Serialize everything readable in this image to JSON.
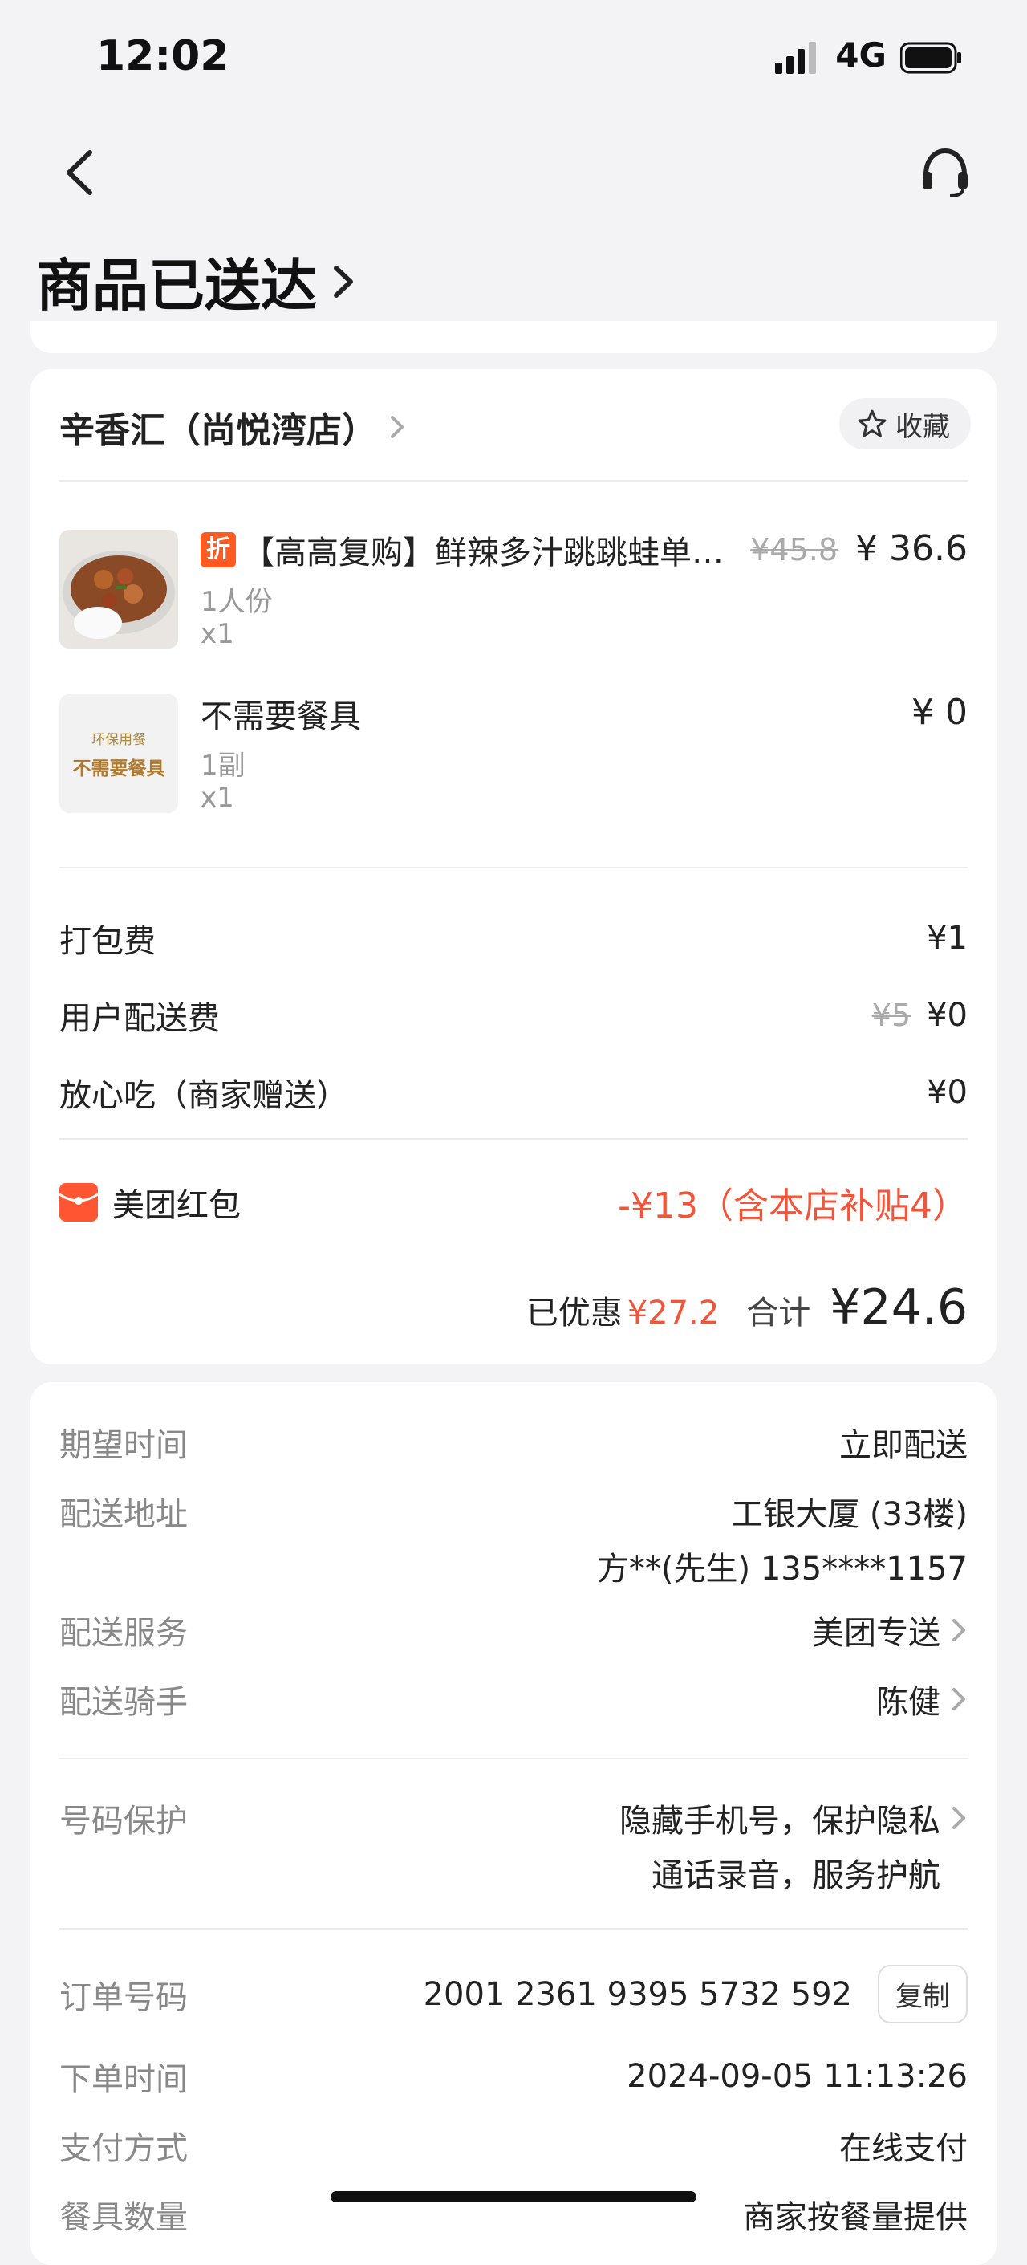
{
  "status": {
    "time": "12:02",
    "network": "4G"
  },
  "header": {
    "title": "商品已送达"
  },
  "shop": {
    "name": "辛香汇（尚悦湾店）",
    "favorite_label": "收藏"
  },
  "items": [
    {
      "tag": "折",
      "name": "【高高复购】鲜辣多汁跳跳蛙单…",
      "spec": "1人份",
      "qty": "x1",
      "original_price": "¥45.8",
      "price": "¥ 36.6"
    },
    {
      "name": "不需要餐具",
      "spec": "1副",
      "qty": "x1",
      "price": "¥ 0",
      "thumb_top": "环保用餐",
      "thumb_main": "不需要餐具"
    }
  ],
  "fees": {
    "packing": {
      "label": "打包费",
      "value": "¥1"
    },
    "delivery": {
      "label": "用户配送费",
      "original": "¥5",
      "value": "¥0"
    },
    "safe_eat": {
      "label": "放心吃（商家赠送）",
      "value": "¥0"
    }
  },
  "red_packet": {
    "label": "美团红包",
    "value": "-¥13（含本店补贴4）"
  },
  "summary": {
    "saved_label": "已优惠",
    "saved_value": "¥27.2",
    "total_label": "合计",
    "total_value": "¥24.6"
  },
  "delivery": {
    "expected_time": {
      "label": "期望时间",
      "value": "立即配送"
    },
    "address": {
      "label": "配送地址",
      "line1": "工银大厦 (33楼)",
      "line2": "方**(先生) 135****1157"
    },
    "service": {
      "label": "配送服务",
      "value": "美团专送"
    },
    "rider": {
      "label": "配送骑手",
      "value": "陈健"
    },
    "privacy": {
      "label": "号码保护",
      "line1": "隐藏手机号，保护隐私",
      "line2": "通话录音，服务护航"
    }
  },
  "order": {
    "number": {
      "label": "订单号码",
      "value": "2001 2361 9395 5732 592",
      "copy_label": "复制"
    },
    "time": {
      "label": "下单时间",
      "value": "2024-09-05 11:13:26"
    },
    "payment": {
      "label": "支付方式",
      "value": "在线支付"
    },
    "tableware": {
      "label": "餐具数量",
      "value": "商家按餐量提供"
    }
  },
  "colors": {
    "accent_red": "#f2553a",
    "tag_orange": "#ff5a1f"
  }
}
